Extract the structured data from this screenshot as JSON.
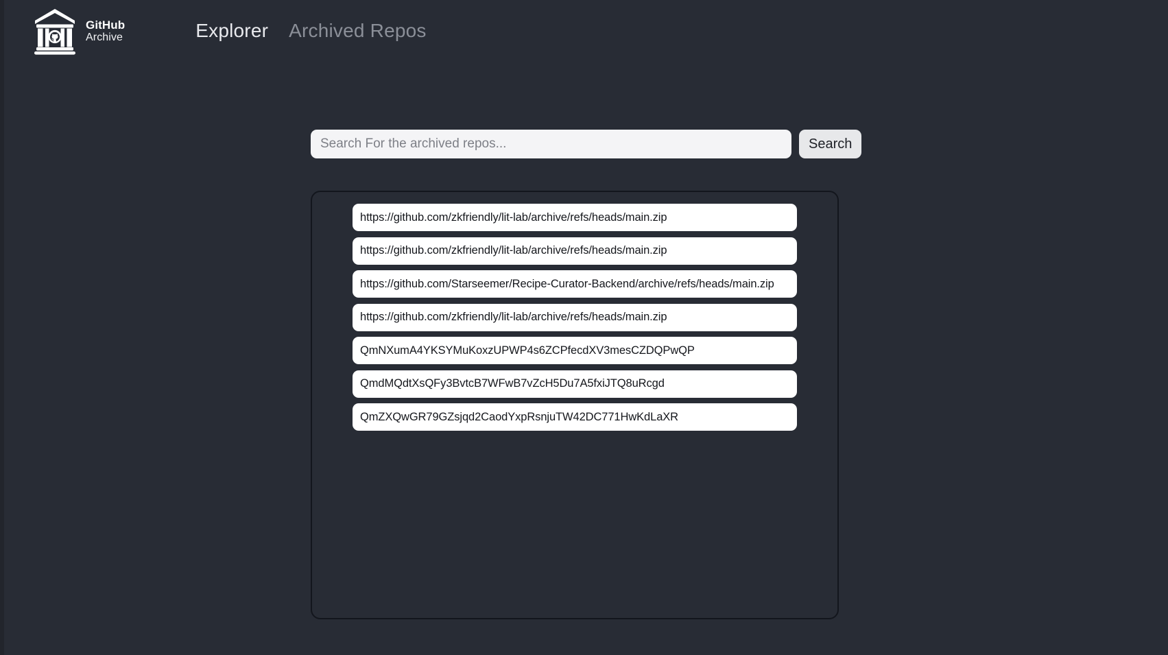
{
  "theme": {
    "background": "#282c35",
    "panel_border": "#13161d",
    "row_background": "#ffffff",
    "row_text": "#15171c",
    "input_background": "#f4f4f6",
    "button_background": "#e7e8ea",
    "nav_active": "#e9eaee",
    "nav_muted": "#8b8f98"
  },
  "brand": {
    "title": "GitHub",
    "subtitle": "Archive",
    "logo_icon": "archive-building-github-icon"
  },
  "nav": {
    "items": [
      {
        "label": "Explorer",
        "state": "active"
      },
      {
        "label": "Archived Repos",
        "state": "muted"
      }
    ]
  },
  "search": {
    "value": "",
    "placeholder": "Search For the archived repos...",
    "button_label": "Search"
  },
  "results": {
    "items": [
      {
        "text": "https://github.com/zkfriendly/lit-lab/archive/refs/heads/main.zip"
      },
      {
        "text": "https://github.com/zkfriendly/lit-lab/archive/refs/heads/main.zip"
      },
      {
        "text": "https://github.com/Starseemer/Recipe-Curator-Backend/archive/refs/heads/main.zip"
      },
      {
        "text": "https://github.com/zkfriendly/lit-lab/archive/refs/heads/main.zip"
      },
      {
        "text": "QmNXumA4YKSYMuKoxzUPWP4s6ZCPfecdXV3mesCZDQPwQP"
      },
      {
        "text": "QmdMQdtXsQFy3BvtcB7WFwB7vZcH5Du7A5fxiJTQ8uRcgd"
      },
      {
        "text": "QmZXQwGR79GZsjqd2CaodYxpRsnjuTW42DC771HwKdLaXR"
      }
    ]
  }
}
